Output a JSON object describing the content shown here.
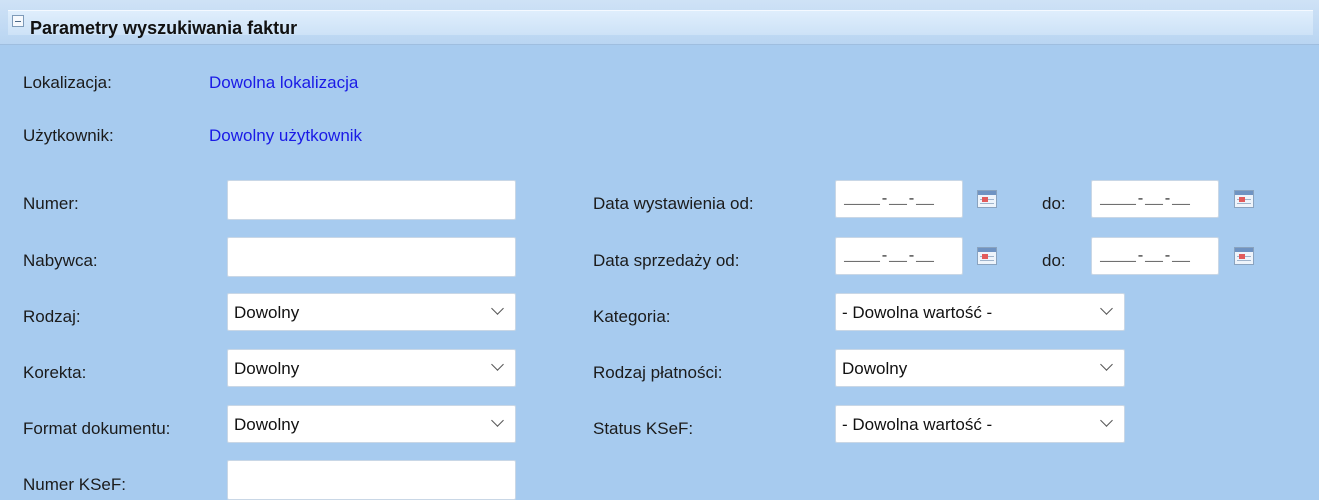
{
  "panel": {
    "title": "Parametry wyszukiwania faktur"
  },
  "location": {
    "label": "Lokalizacja:",
    "value": "Dowolna lokalizacja"
  },
  "user": {
    "label": "Użytkownik:",
    "value": "Dowolny użytkownik"
  },
  "left": {
    "numer_label": "Numer:",
    "nabywca_label": "Nabywca:",
    "rodzaj_label": "Rodzaj:",
    "rodzaj_value": "Dowolny",
    "korekta_label": "Korekta:",
    "korekta_value": "Dowolny",
    "format_label": "Format dokumentu:",
    "format_value": "Dowolny",
    "ksef_label": "Numer KSeF:"
  },
  "right": {
    "data_wyst_label": "Data wystawienia od:",
    "data_sprz_label": "Data sprzedaży od:",
    "do_label": "do:",
    "date_mask": "____-__-__",
    "kategoria_label": "Kategoria:",
    "kategoria_value": "- Dowolna wartość -",
    "platnosc_label": "Rodzaj płatności:",
    "platnosc_value": "Dowolny",
    "status_label": "Status KSeF:",
    "status_value": "- Dowolna wartość -"
  },
  "icons": {
    "collapse": "collapse-minus-icon",
    "calendar": "calendar-icon",
    "dropdown": "chevron-down-icon"
  },
  "colors": {
    "background": "#a7cbef",
    "link": "#1a1ae6"
  }
}
